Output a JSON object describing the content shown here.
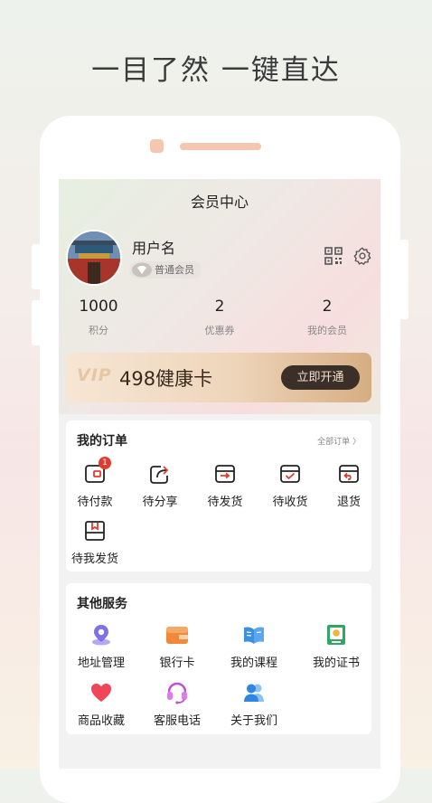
{
  "headline": "一目了然 一键直达",
  "header": {
    "title": "会员中心"
  },
  "profile": {
    "name": "用户名",
    "level": "普通会员"
  },
  "stats": [
    {
      "value": "1000",
      "label": "积分"
    },
    {
      "value": "2",
      "label": "优惠券"
    },
    {
      "value": "2",
      "label": "我的会员"
    }
  ],
  "vip": {
    "logo": "VIP",
    "title": "498健康卡",
    "button": "立即开通"
  },
  "orders": {
    "title": "我的订单",
    "all": "全部订单 〉",
    "items": [
      {
        "label": "待付款",
        "badge": "1",
        "icon": "wallet-pay-icon"
      },
      {
        "label": "待分享",
        "icon": "share-icon"
      },
      {
        "label": "待发货",
        "icon": "ship-icon"
      },
      {
        "label": "待收货",
        "icon": "receive-icon"
      },
      {
        "label": "退货",
        "icon": "return-icon"
      },
      {
        "label": "待我发货",
        "icon": "box-icon"
      }
    ]
  },
  "services": {
    "title": "其他服务",
    "items": [
      {
        "label": "地址管理",
        "icon": "location-icon"
      },
      {
        "label": "银行卡",
        "icon": "bank-card-icon"
      },
      {
        "label": "我的课程",
        "icon": "book-icon"
      },
      {
        "label": "我的证书",
        "icon": "certificate-icon"
      },
      {
        "label": "商品收藏",
        "icon": "heart-icon"
      },
      {
        "label": "客服电话",
        "icon": "headset-icon"
      },
      {
        "label": "关于我们",
        "icon": "people-icon"
      }
    ]
  },
  "colors": {
    "accent_red": "#e23b2f",
    "gold": "#d6ad82",
    "dark_button": "#3a2f29"
  }
}
